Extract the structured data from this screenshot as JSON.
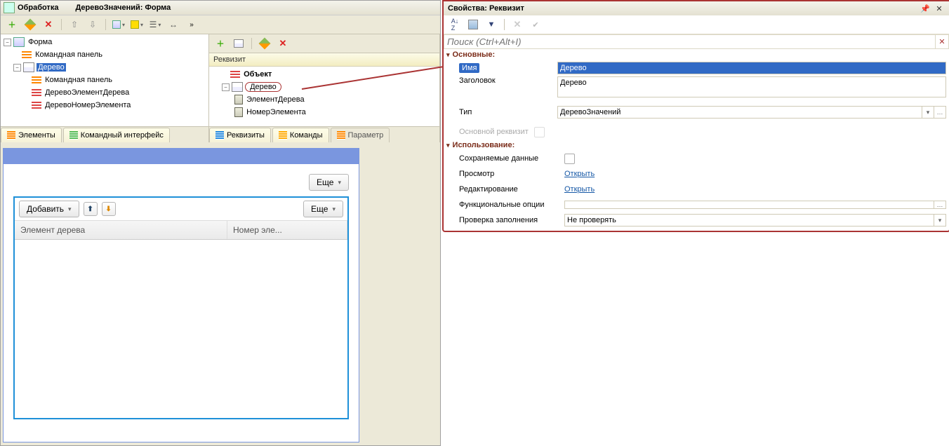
{
  "title_prefix": "Обработка",
  "title_main": "ДеревоЗначений: Форма",
  "left_tree": {
    "root": "Форма",
    "cmd_panel": "Командная панель",
    "tree_item": "Дерево",
    "sub_cmd_panel": "Командная панель",
    "elem_tree": "ДеревоЭлементДерева",
    "num_elem": "ДеревоНомерЭлемента"
  },
  "right_header": "Реквизит",
  "right_tree": {
    "object": "Объект",
    "tree": "Дерево",
    "elem": "ЭлементДерева",
    "num": "НомерЭлемента"
  },
  "tabs_left": {
    "elements": "Элементы",
    "cmd_iface": "Командный интерфейс"
  },
  "tabs_right": {
    "reqs": "Реквизиты",
    "cmds": "Команды",
    "params": "Параметр"
  },
  "preview": {
    "more": "Еще",
    "add": "Добавить",
    "more2": "Еще",
    "col1": "Элемент дерева",
    "col2": "Номер эле..."
  },
  "props": {
    "title": "Свойства: Реквизит",
    "search_ph": "Поиск (Ctrl+Alt+I)",
    "sec_main": "Основные:",
    "name_lbl": "Имя",
    "name_val": "Дерево",
    "title_lbl": "Заголовок",
    "title_val": "Дерево",
    "type_lbl": "Тип",
    "type_val": "ДеревоЗначений",
    "main_req": "Основной реквизит",
    "sec_use": "Использование:",
    "saved_data": "Сохраняемые данные",
    "view_lbl": "Просмотр",
    "open": "Открыть",
    "edit_lbl": "Редактирование",
    "func_opts": "Функциональные опции",
    "check_fill": "Проверка заполнения",
    "check_val": "Не проверять"
  }
}
